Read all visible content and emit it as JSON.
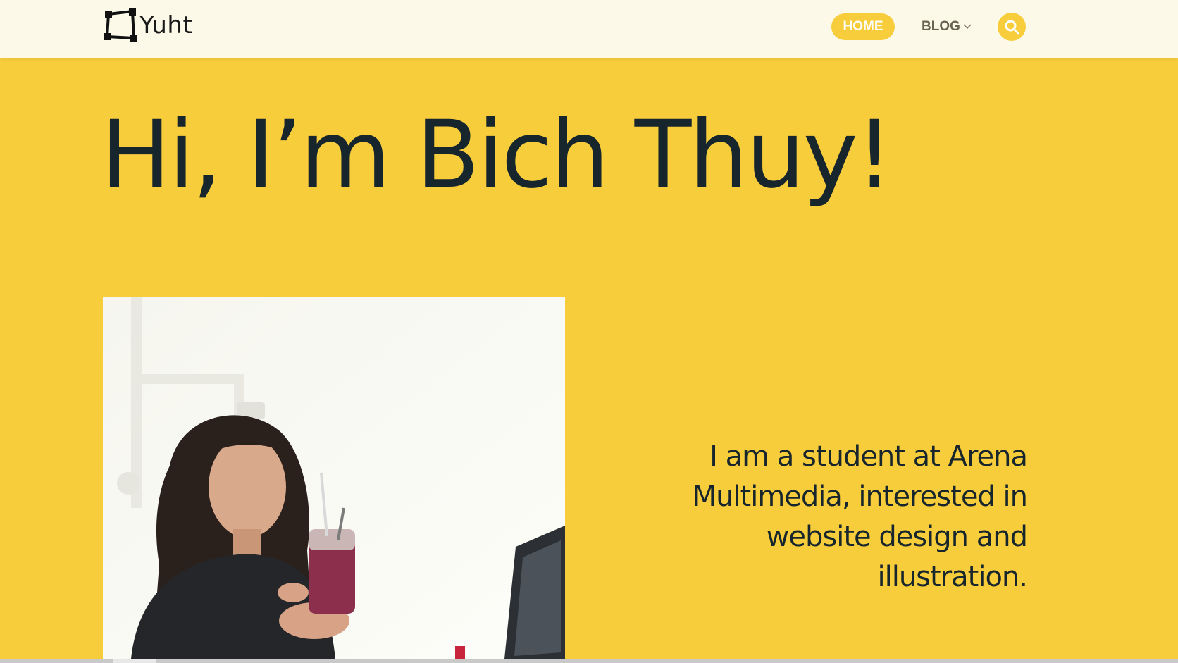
{
  "header": {
    "logo_text": "Yuht",
    "nav": {
      "home_label": "HOME",
      "blog_label": "BLOG"
    },
    "search_icon": "search-icon"
  },
  "hero": {
    "title": "Hi, I’m Bich Thuy!",
    "intro_lines": [
      "I am a student at Arena",
      "Multimedia, interested in",
      "website design and",
      "illustration."
    ]
  },
  "colors": {
    "page_bg": "#f8cd3c",
    "header_bg": "#fdf9e8",
    "text_dark": "#17252c",
    "accent": "#f8cd3c"
  }
}
